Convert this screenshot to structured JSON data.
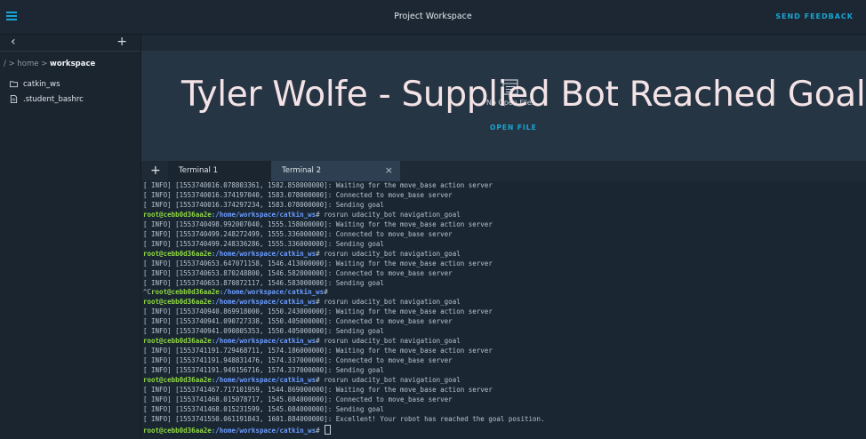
{
  "header": {
    "title": "Project Workspace",
    "send_feedback": "SEND FEEDBACK"
  },
  "sidebar": {
    "back": "‹",
    "add": "+",
    "breadcrumb": {
      "root": "/",
      "sep1": ">",
      "home": "home",
      "sep2": ">",
      "current": "workspace"
    },
    "files": [
      {
        "name": "catkin_ws",
        "icon": "folder-icon"
      },
      {
        "name": ".student_bashrc",
        "icon": "file-icon"
      }
    ]
  },
  "editor": {
    "empty_text": "No Open Files",
    "open_file": "OPEN FILE"
  },
  "overlay": {
    "title": "Tyler Wolfe - Supplied Bot Reached Goal"
  },
  "tabs": {
    "add": "+",
    "items": [
      {
        "label": "Terminal 1",
        "close": "×",
        "active": false
      },
      {
        "label": "Terminal 2",
        "close": "×",
        "active": true
      }
    ]
  },
  "terminal": {
    "prompt_user": "root@cebb0d36aa2e",
    "prompt_path": ":/home/workspace/catkin_ws",
    "lines": [
      "[ INFO] [1553740016.078803361, 1582.858000000]: Waiting for the move_base action server",
      "[ INFO] [1553740016.374197040, 1583.078000000]: Connected to move_base server",
      "[ INFO] [1553740016.374297234, 1583.078000000]: Sending goal",
      "P# rosrun udacity_bot navigation_goal",
      "[ INFO] [1553740498.992007040, 1555.158000000]: Waiting for the move_base action server",
      "[ INFO] [1553740499.248272499, 1555.336000000]: Connected to move_base server",
      "[ INFO] [1553740499.248336286, 1555.336000000]: Sending goal",
      "P# rosrun udacity_bot navigation_goal",
      "[ INFO] [1553740653.647071158, 1546.413000000]: Waiting for the move_base action server",
      "[ INFO] [1553740653.870248800, 1546.582000000]: Connected to move_base server",
      "[ INFO] [1553740653.870872117, 1546.583000000]: Sending goal",
      "^CP#",
      "P# rosrun udacity_bot navigation_goal",
      "[ INFO] [1553740940.869918000, 1550.243000000]: Waiting for the move_base action server",
      "[ INFO] [1553740941.090727338, 1550.405000000]: Connected to move_base server",
      "[ INFO] [1553740941.090805353, 1550.405000000]: Sending goal",
      "P# rosrun udacity_bot navigation_goal",
      "[ INFO] [1553741191.729468711, 1574.186000000]: Waiting for the move_base action server",
      "[ INFO] [1553741191.948831476, 1574.337000000]: Connected to move_base server",
      "[ INFO] [1553741191.949156716, 1574.337000000]: Sending goal",
      "P# rosrun udacity_bot navigation_goal",
      "[ INFO] [1553741467.717101959, 1544.869000000]: Waiting for the move_base action server",
      "[ INFO] [1553741468.015078717, 1545.084000000]: Connected to move_base server",
      "[ INFO] [1553741468.015231599, 1545.084000000]: Sending goal",
      "[ INFO] [1553741550.061191843, 1601.884000000]: Excellent! Your robot has reached the goal position.",
      "P#"
    ]
  },
  "colors": {
    "accent": "#17a6d4",
    "prompt_user": "#8fd640",
    "prompt_path": "#6b9bff",
    "overlay_text": "#f4e3e6"
  }
}
